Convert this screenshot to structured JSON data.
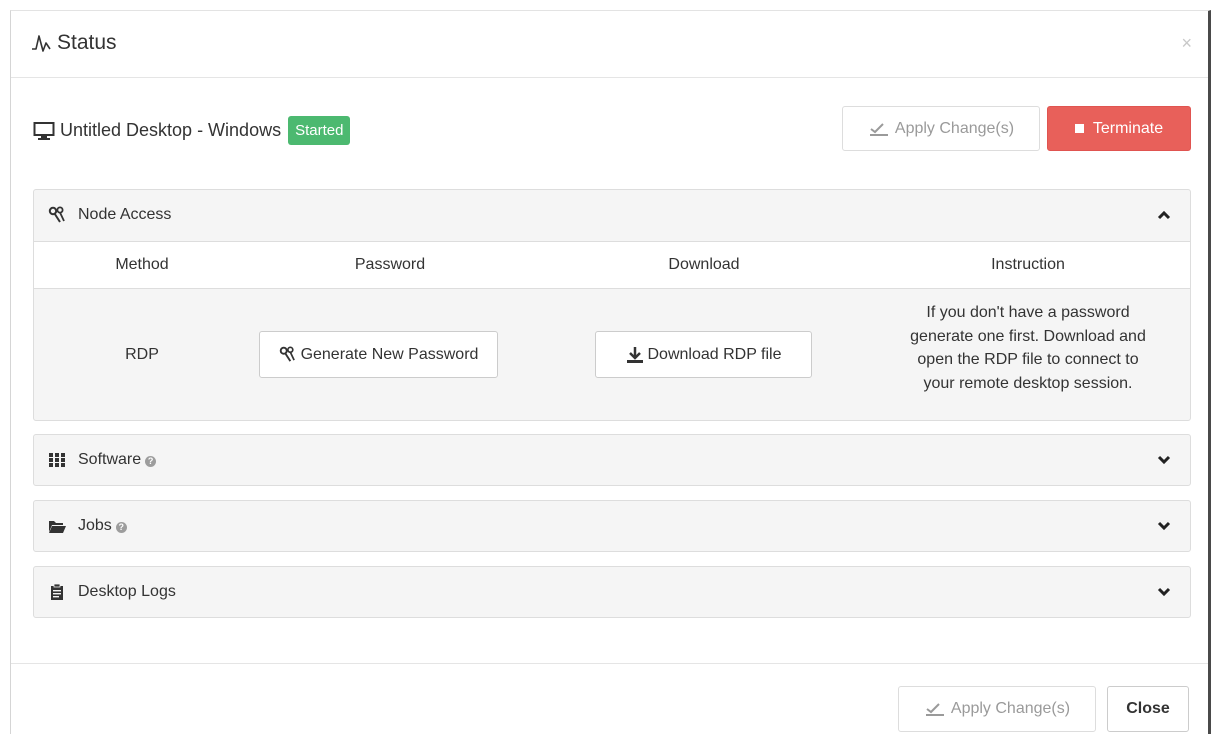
{
  "header": {
    "title": "Status",
    "title_icon": "pulse-icon",
    "close_label": "×"
  },
  "desktop": {
    "name": "Untitled Desktop - Windows",
    "status": "Started",
    "status_color": "#4cb970",
    "apply_label": "Apply Change(s)",
    "terminate_label": "Terminate",
    "terminate_color": "#e8605a"
  },
  "node_access": {
    "title": "Node Access",
    "expanded": true,
    "columns": [
      "Method",
      "Password",
      "Download",
      "Instruction"
    ],
    "rows": [
      {
        "method": "RDP",
        "password_button": "Generate New Password",
        "download_button": "Download RDP file",
        "instruction_lines": [
          "If you don't have a password",
          "generate one first. Download and",
          "open the RDP file to connect to",
          "your remote desktop session."
        ]
      }
    ]
  },
  "panels": [
    {
      "title": "Software",
      "icon": "grid-icon",
      "help": true,
      "expanded": false
    },
    {
      "title": "Jobs",
      "icon": "folder-open-icon",
      "help": true,
      "expanded": false
    },
    {
      "title": "Desktop Logs",
      "icon": "clipboard-icon",
      "help": false,
      "expanded": false
    }
  ],
  "footer": {
    "apply_label": "Apply Change(s)",
    "close_label": "Close"
  }
}
